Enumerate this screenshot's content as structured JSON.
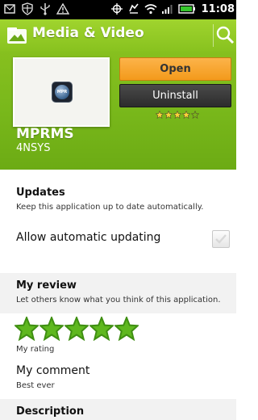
{
  "status_bar": {
    "time": "11:08"
  },
  "header": {
    "title": "Media & Video",
    "open_label": "Open",
    "uninstall_label": "Uninstall",
    "app_name": "MPRMS",
    "developer": "4NSYS",
    "icon_text": "MPR",
    "rating_stars": 4
  },
  "updates": {
    "title": "Updates",
    "subtitle": "Keep this application up to date automatically.",
    "toggle_label": "Allow automatic updating",
    "checked": false
  },
  "review": {
    "title": "My review",
    "subtitle": "Let others know what you think of this application.",
    "my_rating": 5,
    "rating_label": "My rating",
    "comment_title": "My comment",
    "comment_text": "Best ever"
  },
  "description": {
    "title": "Description"
  },
  "colors": {
    "header_green": "#79b81b",
    "open_orange": "#f39a1b",
    "star_green": "#5fb81f"
  }
}
